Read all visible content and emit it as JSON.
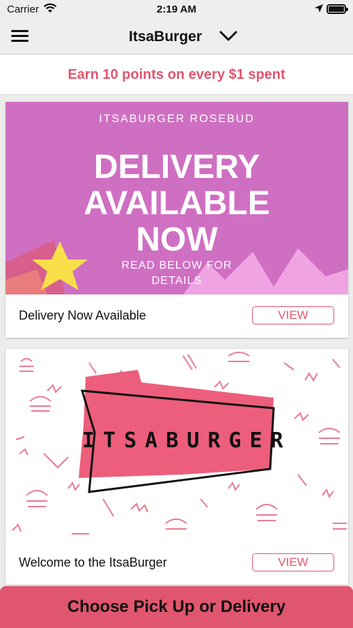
{
  "status_bar": {
    "carrier": "Carrier",
    "time": "2:19 AM"
  },
  "nav": {
    "title": "ItsaBurger",
    "menu_icon": "hamburger-menu-icon",
    "dropdown_icon": "chevron-down-icon"
  },
  "points_banner": {
    "text": "Earn 10 points on every $1 spent"
  },
  "cards": [
    {
      "image": {
        "kicker": "ITSABURGER ROSEBUD",
        "headline": [
          "DELIVERY",
          "AVAILABLE",
          "NOW"
        ],
        "sub": [
          "READ BELOW FOR",
          "DETAILS"
        ]
      },
      "caption": "Delivery Now Available",
      "button_label": "VIEW"
    },
    {
      "image": {
        "logo_text": "ITSABURGER"
      },
      "caption": "Welcome to the ItsaBurger",
      "button_label": "VIEW"
    }
  ],
  "bottom_cta": {
    "label": "Choose Pick Up or Delivery"
  },
  "colors": {
    "accent": "#e0566f",
    "promo_bg": "#cf6fc2",
    "star": "#f9e04b",
    "logo_ribbon": "#ec5e7c"
  }
}
